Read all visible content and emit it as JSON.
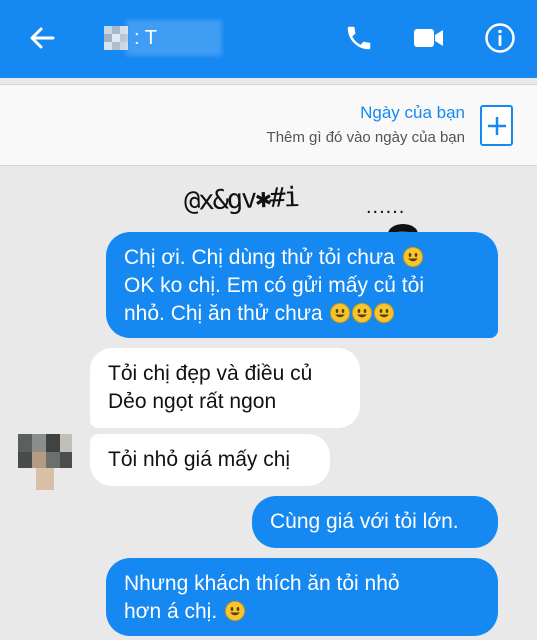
{
  "header": {
    "contact_name": ": T",
    "icons": [
      "back-arrow-icon",
      "phone-icon",
      "video-camera-icon",
      "info-icon"
    ]
  },
  "day_card": {
    "title": "Ngày của bạn",
    "subtitle": "Thêm gì đó vào ngày của bạn"
  },
  "scribble": {
    "text": "@x&gv✱#i",
    "trail": "......"
  },
  "messages": [
    {
      "direction": "outgoing",
      "lines": [
        "Chị ơi. Chị dùng thử tỏi chưa",
        "OK ko chị. Em có gửi mấy củ tỏi",
        "nhỏ. Chị ăn thử chưa"
      ]
    },
    {
      "direction": "incoming",
      "lines": [
        "Tỏi chị đẹp và điều củ",
        "Dẻo ngọt rất ngon"
      ]
    },
    {
      "direction": "incoming",
      "lines": [
        "Tỏi nhỏ giá mấy chị"
      ]
    },
    {
      "direction": "outgoing",
      "lines": [
        "Cùng giá với tỏi lớn."
      ]
    },
    {
      "direction": "outgoing",
      "lines": [
        "Nhưng khách thích ăn tỏi nhỏ",
        "hơn á chị."
      ]
    }
  ],
  "colors": {
    "brand_blue": "#1588f2",
    "background": "#e9e9ea",
    "incoming_bubble": "#ffffff",
    "emoji_yellow": "#f7c52c"
  }
}
